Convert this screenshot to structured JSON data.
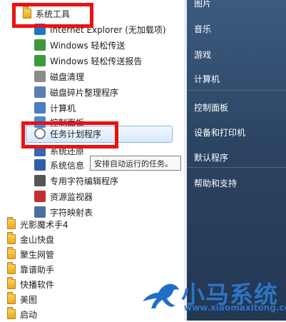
{
  "left_menu": {
    "folder_system_tools": "系统工具",
    "items": [
      {
        "label": "Internet Explorer (无加载项)",
        "icon": "internet-explorer-icon",
        "color": "#1a78c8"
      },
      {
        "label": "Windows 轻松传送",
        "icon": "easy-transfer-icon",
        "color": "#3a9a3a"
      },
      {
        "label": "Windows 轻松传送报告",
        "icon": "easy-transfer-report-icon",
        "color": "#3a9a3a"
      },
      {
        "label": "磁盘清理",
        "icon": "disk-cleanup-icon",
        "color": "#8c8c8c"
      },
      {
        "label": "磁盘碎片整理程序",
        "icon": "defragmenter-icon",
        "color": "#5b7fb5"
      },
      {
        "label": "计算机",
        "icon": "computer-icon",
        "color": "#4a7cc1"
      },
      {
        "label": "控制面板",
        "icon": "control-panel-icon",
        "color": "#3c8fd6"
      },
      {
        "label": "任务计划程序",
        "icon": "clock-icon",
        "color": "#777777"
      },
      {
        "label": "系统还原",
        "icon": "system-restore-icon",
        "color": "#3a66b0"
      },
      {
        "label": "系统信息",
        "icon": "system-info-icon",
        "color": "#2f5fa8"
      },
      {
        "label": "专用字符编辑程序",
        "icon": "char-editor-icon",
        "color": "#555555"
      },
      {
        "label": "资源监视器",
        "icon": "resource-monitor-icon",
        "color": "#c03030"
      },
      {
        "label": "字符映射表",
        "icon": "charmap-icon",
        "color": "#4a6fa5"
      }
    ],
    "folders": [
      "光影魔术手4",
      "金山快盘",
      "聚生网管",
      "靠谱助手",
      "快播软件",
      "美图",
      "启动"
    ]
  },
  "tooltip": "安排自动运行的任务。",
  "right_menu": {
    "items": [
      "图片",
      "音乐",
      "游戏",
      "计算机",
      "控制面板",
      "设备和打印机",
      "默认程序",
      "帮助和支持"
    ]
  },
  "watermark": {
    "name": "小马系统",
    "url": "www.xiaomaxitong.com"
  },
  "colors": {
    "highlight_red": "#ee1010",
    "brand_blue": "#2e74c4"
  }
}
